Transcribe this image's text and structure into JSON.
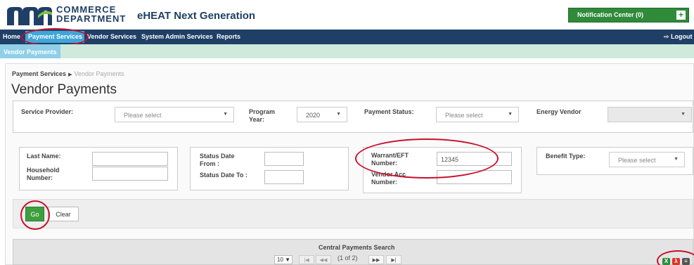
{
  "header": {
    "logo_line1": "COMMERCE",
    "logo_line2": "DEPARTMENT",
    "app_title": "eHEAT Next Generation",
    "notification_label": "Notification Center (0)",
    "notification_icon": "plus-icon"
  },
  "nav": {
    "items": [
      "Home",
      "Payment Services",
      "Vendor Services",
      "System Admin Services",
      "Reports"
    ],
    "active": "Payment Services",
    "logout_label": "Logout",
    "logout_icon": "logout-icon"
  },
  "subnav": {
    "active_tab": "Vendor Payments"
  },
  "breadcrumb": {
    "parent": "Payment Services",
    "current": "Vendor Payments"
  },
  "page_title": "Vendor Payments",
  "filters": {
    "service_provider": {
      "label": "Service Provider:",
      "value": "Please select"
    },
    "program_year": {
      "label": "Program Year:",
      "value": "2020"
    },
    "payment_status": {
      "label": "Payment Status:",
      "value": "Please select"
    },
    "energy_vendor": {
      "label": "Energy Vendor",
      "value": ""
    }
  },
  "search": {
    "last_name_label": "Last Name:",
    "household_label": "Household Number:",
    "status_from_label": "Status Date From :",
    "status_to_label": "Status Date To :",
    "warrant_label": "Warrant/EFT Number:",
    "warrant_value": "12345",
    "vendor_acc_label": "Vendor Acc Number:",
    "benefit_label": "Benefit Type:",
    "benefit_value": "Please select"
  },
  "actions": {
    "go_label": "Go",
    "clear_label": "Clear"
  },
  "grid": {
    "title": "Central Payments Search",
    "page_size": "10",
    "page_info": "(1 of 2)"
  },
  "colors": {
    "nav_bg": "#1f3f66",
    "nav_active": "#3fa6d8",
    "notification_green": "#2f8a3a",
    "go_green": "#3d9f3d",
    "annotation_red": "#c8102e"
  }
}
